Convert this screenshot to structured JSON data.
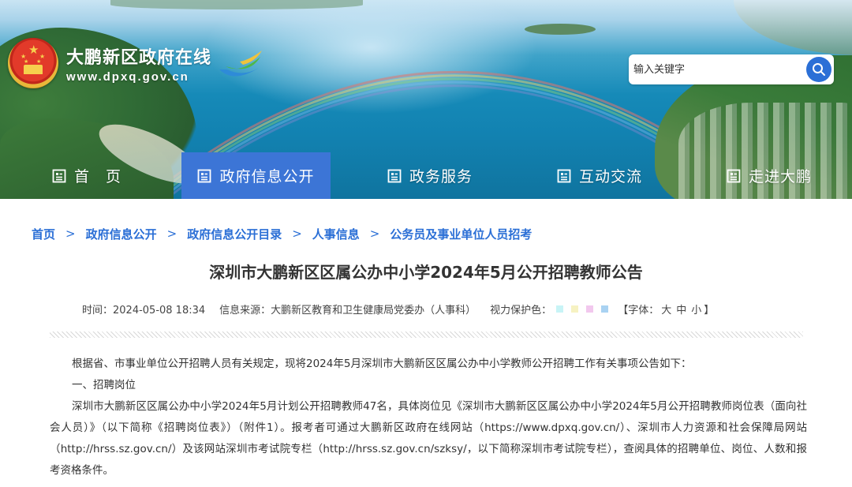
{
  "header": {
    "site_title": "大鹏新区政府在线",
    "site_url": "www.dpxq.gov.cn"
  },
  "search": {
    "placeholder": "输入关键字"
  },
  "nav": {
    "items": [
      {
        "label": "首　页"
      },
      {
        "label": "政府信息公开"
      },
      {
        "label": "政务服务"
      },
      {
        "label": "互动交流"
      },
      {
        "label": "走进大鹏"
      }
    ]
  },
  "breadcrumb": {
    "items": [
      "首页",
      "政府信息公开",
      "政府信息公开目录",
      "人事信息",
      "公务员及事业单位人员招考"
    ],
    "separator": ">"
  },
  "article": {
    "title": "深圳市大鹏新区区属公办中小学2024年5月公开招聘教师公告",
    "time": "时间：2024-05-08 18:34",
    "source": "信息来源：大鹏新区教育和卫生健康局党委办（人事科）",
    "eye_care_label": "视力保护色：",
    "font_label_open": "【字体：",
    "font_options": [
      "大",
      "中",
      "小"
    ],
    "font_label_close": "】",
    "paragraphs": [
      "根据省、市事业单位公开招聘人员有关规定，现将2024年5月深圳市大鹏新区区属公办中小学教师公开招聘工作有关事项公告如下：",
      "一、招聘岗位",
      "深圳市大鹏新区区属公办中小学2024年5月计划公开招聘教师47名，具体岗位见《深圳市大鹏新区区属公办中小学2024年5月公开招聘教师岗位表（面向社会人员）》（以下简称《招聘岗位表》）（附件1）。报考者可通过大鹏新区政府在线网站（https://www.dpxq.gov.cn/）、深圳市人力资源和社会保障局网站（http://hrss.sz.gov.cn/）及该网站深圳市考试院专栏（http://hrss.sz.gov.cn/szksy/，以下简称深圳市考试院专栏），查阅具体的招聘单位、岗位、人数和报考资格条件。"
    ]
  },
  "colors": {
    "accent": "#3c75d6",
    "link": "#2b6fd6",
    "swatches": [
      "#c8f4f6",
      "#f6f2c2",
      "#f2c8ee",
      "#a9d2f2"
    ]
  }
}
